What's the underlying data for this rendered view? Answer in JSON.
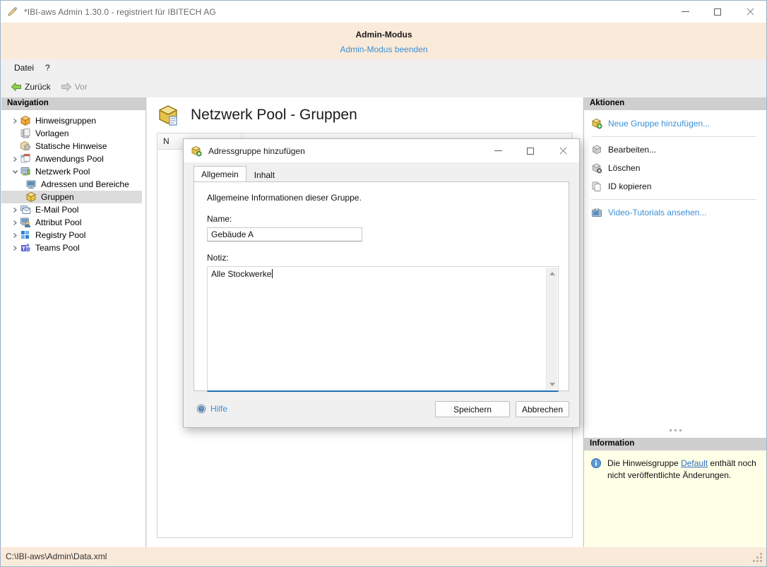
{
  "window": {
    "title": "*IBI-aws Admin 1.30.0 - registriert für IBITECH AG",
    "icon": "pencil-app-icon",
    "minimize_label": "Minimieren",
    "maximize_label": "Maximieren",
    "close_label": "Schließen"
  },
  "admin_banner": {
    "title": "Admin-Modus",
    "exit_link": "Admin-Modus beenden"
  },
  "menu": {
    "items": [
      {
        "label": "Datei",
        "name": "menu-datei"
      },
      {
        "label": "?",
        "name": "menu-help"
      }
    ]
  },
  "nav_toolbar": {
    "back_label": "Zurück",
    "forward_label": "Vor",
    "back_icon": "arrow-left-icon",
    "forward_icon": "arrow-right-icon"
  },
  "navigation": {
    "header": "Navigation",
    "items": [
      {
        "label": "Hinweisgruppen",
        "icon": "box-orange-icon",
        "expander": "collapsed",
        "level": 1,
        "selected": false
      },
      {
        "label": "Vorlagen",
        "icon": "templates-icon",
        "expander": "none",
        "level": 1,
        "selected": false
      },
      {
        "label": "Statische Hinweise",
        "icon": "gear-box-icon",
        "expander": "none",
        "level": 1,
        "selected": false
      },
      {
        "label": "Anwendungs Pool",
        "icon": "windows-stack-icon",
        "expander": "collapsed",
        "level": 1,
        "selected": false
      },
      {
        "label": "Netzwerk Pool",
        "icon": "monitor-green-icon",
        "expander": "expanded",
        "level": 1,
        "selected": false
      },
      {
        "label": "Adressen und Bereiche",
        "icon": "monitor-blue-icon",
        "expander": "none",
        "level": 2,
        "selected": false
      },
      {
        "label": "Gruppen",
        "icon": "box-yellow-icon",
        "expander": "none",
        "level": 2,
        "selected": true
      },
      {
        "label": "E-Mail Pool",
        "icon": "mail-icon",
        "expander": "collapsed",
        "level": 1,
        "selected": false
      },
      {
        "label": "Attribut Pool",
        "icon": "user-monitor-icon",
        "expander": "collapsed",
        "level": 1,
        "selected": false
      },
      {
        "label": "Registry Pool",
        "icon": "grid-blue-icon",
        "expander": "collapsed",
        "level": 1,
        "selected": false
      },
      {
        "label": "Teams Pool",
        "icon": "teams-icon",
        "expander": "collapsed",
        "level": 1,
        "selected": false
      }
    ]
  },
  "content": {
    "title": "Netzwerk Pool - Gruppen",
    "icon": "box-page-icon",
    "grid_columns": [
      "N"
    ]
  },
  "actions": {
    "header": "Aktionen",
    "items": [
      {
        "label": "Neue Gruppe hinzufügen...",
        "icon": "box-add-icon",
        "style": "link",
        "name": "action-add-group"
      },
      {
        "label": "Bearbeiten...",
        "icon": "box-edit-icon",
        "style": "plain",
        "name": "action-edit"
      },
      {
        "label": "Löschen",
        "icon": "box-delete-icon",
        "style": "plain",
        "name": "action-delete"
      },
      {
        "label": "ID kopieren",
        "icon": "copy-icon",
        "style": "plain",
        "name": "action-copy-id"
      },
      {
        "label": "Video-Tutorials ansehen...",
        "icon": "tv-icon",
        "style": "link",
        "name": "action-video-tutorials"
      }
    ],
    "separator_after": [
      0,
      3
    ]
  },
  "information": {
    "header": "Information",
    "icon": "info-icon",
    "text_before": "Die Hinweisgruppe ",
    "link": "Default",
    "text_after": " enthält noch nicht veröffentlichte Änderungen."
  },
  "status_bar": {
    "path": "C:\\IBI-aws\\Admin\\Data.xml"
  },
  "dialog": {
    "title": "Adressgruppe hinzufügen",
    "icon": "box-add-icon",
    "minimize_label": "Minimieren",
    "maximize_label": "Maximieren",
    "close_label": "Schließen",
    "tabs": [
      {
        "label": "Allgemein",
        "active": true,
        "name": "tab-allgemein"
      },
      {
        "label": "Inhalt",
        "active": false,
        "name": "tab-inhalt"
      }
    ],
    "description": "Allgemeine Informationen dieser Gruppe.",
    "name_label": "Name:",
    "name_value": "Gebäude A",
    "name_placeholder": "",
    "note_label": "Notiz:",
    "note_value": "Alle Stockwerke",
    "note_placeholder": "",
    "help_label": "Hilfe",
    "help_icon": "help-icon",
    "save_label": "Speichern",
    "cancel_label": "Abbrechen"
  },
  "colors": {
    "admin_banner_bg": "#faeada",
    "link_blue": "#3b8fd6",
    "panel_header_bg": "#cfcfcf",
    "info_panel_bg": "#ffffe8",
    "focus_underline": "#1e6fb8",
    "selection_bg": "#dcdcdc"
  }
}
